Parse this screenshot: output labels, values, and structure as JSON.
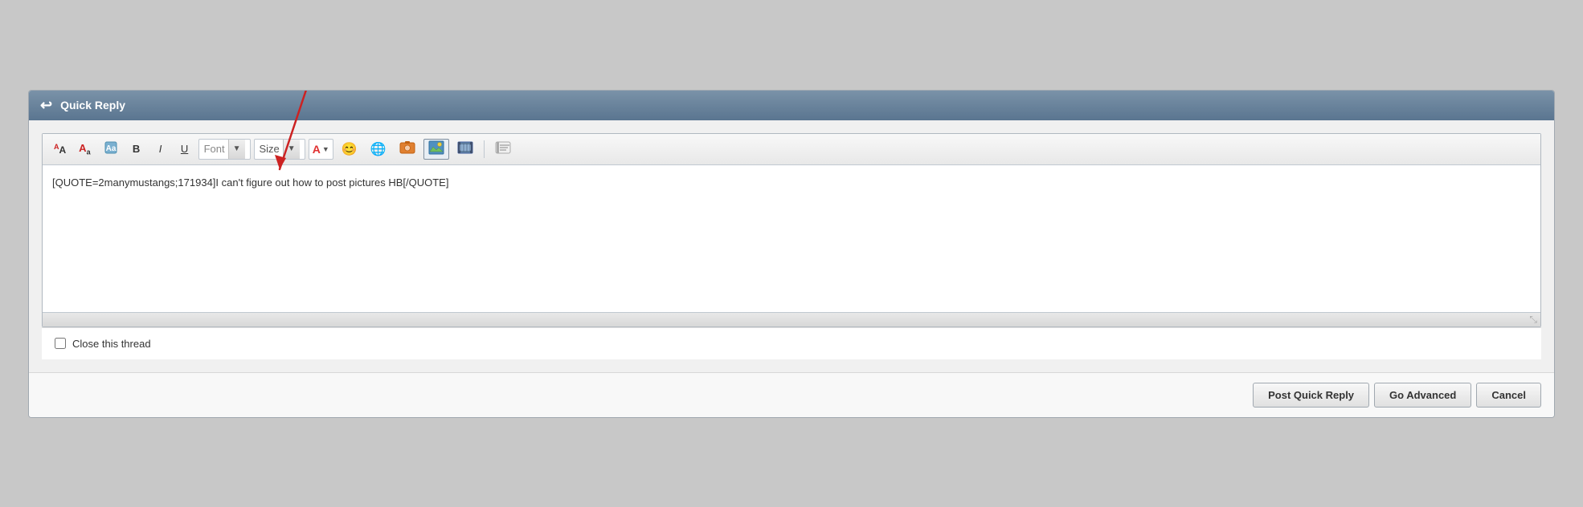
{
  "panel": {
    "title": "Quick Reply",
    "back_icon": "↩"
  },
  "toolbar": {
    "font_size_label": "Font",
    "font_size_placeholder": "Font",
    "size_label": "Size",
    "bold_label": "B",
    "italic_label": "I",
    "underline_label": "U",
    "color_label": "A",
    "dropdown_arrow": "▼",
    "emoji_label": "😊",
    "globe_label": "🌐",
    "image_label": "🖼",
    "film_label": "🎞",
    "quote_label": "💬",
    "shrink_label": "Aᴬ",
    "grow_label": "Aᴬ"
  },
  "textarea": {
    "content": "[QUOTE=2manymustangs;171934]I can't figure out how to post pictures HB[/QUOTE]"
  },
  "close_thread": {
    "label": "Close this thread"
  },
  "buttons": {
    "post_quick_reply": "Post Quick Reply",
    "go_advanced": "Go Advanced",
    "cancel": "Cancel"
  }
}
